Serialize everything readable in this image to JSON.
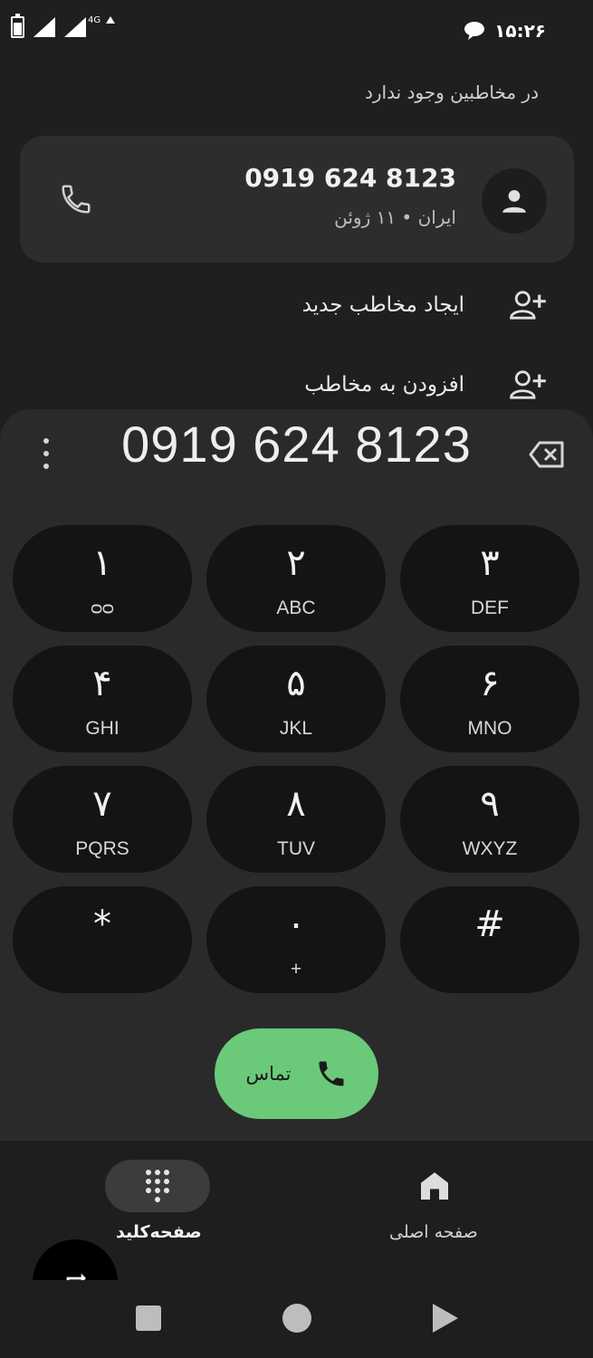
{
  "status_bar": {
    "network_label": "4G",
    "time": "۱۵:۲۶"
  },
  "contacts": {
    "no_contact_text": "در مخاطبین وجود ندارد",
    "card": {
      "number": "0919 624 8123",
      "subtitle": "ایران • ۱۱ ژوئن"
    },
    "actions": [
      {
        "label": "ایجاد مخاطب جدید",
        "icon": "add-person-icon"
      },
      {
        "label": "افزودن به مخاطب",
        "icon": "add-person-icon"
      }
    ]
  },
  "dialer": {
    "dialed_number": "0919 624 8123",
    "keys": [
      {
        "digit": "۱",
        "letters": "ᴑᴑ"
      },
      {
        "digit": "۲",
        "letters": "ABC"
      },
      {
        "digit": "۳",
        "letters": "DEF"
      },
      {
        "digit": "۴",
        "letters": "GHI"
      },
      {
        "digit": "۵",
        "letters": "JKL"
      },
      {
        "digit": "۶",
        "letters": "MNO"
      },
      {
        "digit": "۷",
        "letters": "PQRS"
      },
      {
        "digit": "۸",
        "letters": "TUV"
      },
      {
        "digit": "۹",
        "letters": "WXYZ"
      },
      {
        "digit": "*",
        "letters": ""
      },
      {
        "digit": "۰",
        "letters": "+"
      },
      {
        "digit": "#",
        "letters": ""
      }
    ],
    "call_label": "تماس"
  },
  "bottom_nav": {
    "keypad_label": "صفحه‌کلید",
    "home_label": "صفحه اصلی"
  },
  "colors": {
    "background": "#1f1f1f",
    "sheet": "#2a2a2a",
    "key": "#141414",
    "call_green": "#6bc97a"
  }
}
